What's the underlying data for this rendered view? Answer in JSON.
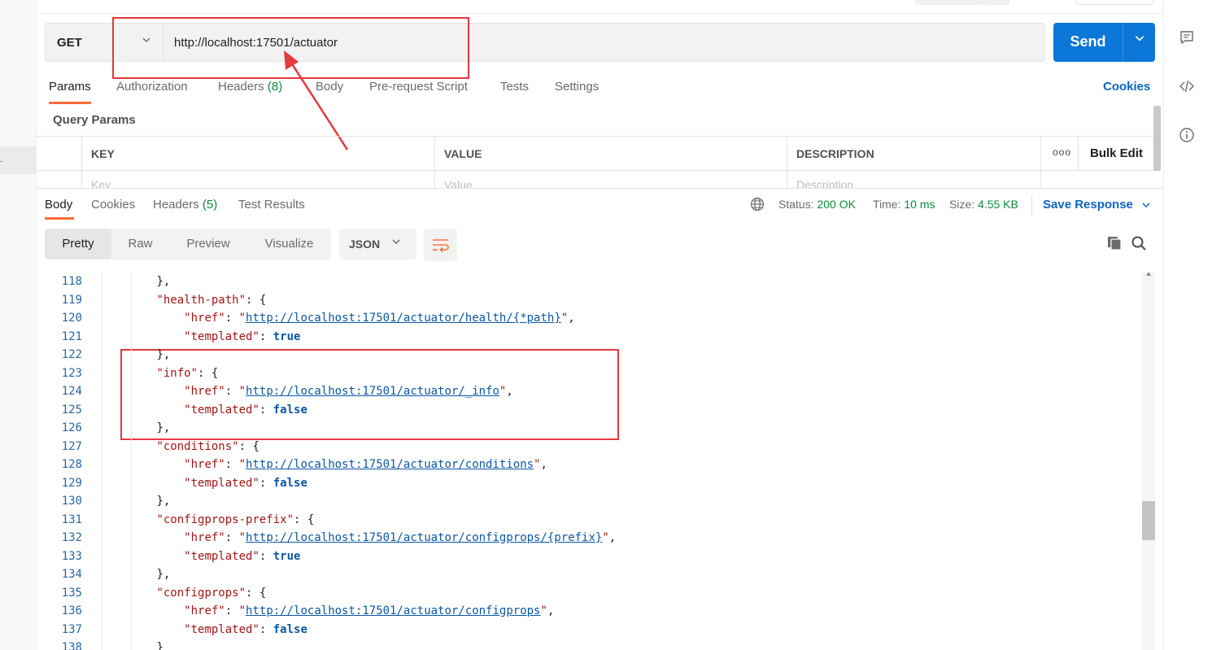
{
  "request": {
    "method": "GET",
    "url": "http://localhost:17501/actuator",
    "send_label": "Send"
  },
  "request_tabs": [
    {
      "label": "Params"
    },
    {
      "label": "Authorization"
    },
    {
      "label": "Headers",
      "count": "(8)"
    },
    {
      "label": "Body"
    },
    {
      "label": "Pre-request Script"
    },
    {
      "label": "Tests"
    },
    {
      "label": "Settings"
    }
  ],
  "cookies_label": "Cookies",
  "query_params": {
    "title": "Query Params",
    "headers": [
      "KEY",
      "VALUE",
      "DESCRIPTION"
    ],
    "placeholders": [
      "Key",
      "Value",
      "Description"
    ],
    "more_label": "ooo",
    "bulk_edit_label": "Bulk Edit"
  },
  "response_tabs": [
    {
      "label": "Body"
    },
    {
      "label": "Cookies"
    },
    {
      "label": "Headers",
      "count": "(5)"
    },
    {
      "label": "Test Results"
    }
  ],
  "status": {
    "status_label": "Status:",
    "status_value": "200 OK",
    "time_label": "Time:",
    "time_value": "10 ms",
    "size_label": "Size:",
    "size_value": "4.55 KB"
  },
  "save_response_label": "Save Response",
  "format_tabs": [
    "Pretty",
    "Raw",
    "Preview",
    "Visualize"
  ],
  "format_select": "JSON",
  "colors": {
    "accent": "#ff6c37",
    "send_blue": "#0b77d8",
    "link_blue": "#0b66c3",
    "success_green": "#0d8a3c",
    "annotation_red": "#e6383d"
  },
  "code_lines": [
    {
      "n": "118",
      "t": "        },"
    },
    {
      "n": "119",
      "t": "        \"health-path\": {"
    },
    {
      "n": "120",
      "t": "            \"href\": \"http://localhost:17501/actuator/health/{*path}\","
    },
    {
      "n": "121",
      "t": "            \"templated\": true"
    },
    {
      "n": "122",
      "t": "        },"
    },
    {
      "n": "123",
      "t": "        \"info\": {"
    },
    {
      "n": "124",
      "t": "            \"href\": \"http://localhost:17501/actuator/_info\","
    },
    {
      "n": "125",
      "t": "            \"templated\": false"
    },
    {
      "n": "126",
      "t": "        },"
    },
    {
      "n": "127",
      "t": "        \"conditions\": {"
    },
    {
      "n": "128",
      "t": "            \"href\": \"http://localhost:17501/actuator/conditions\","
    },
    {
      "n": "129",
      "t": "            \"templated\": false"
    },
    {
      "n": "130",
      "t": "        },"
    },
    {
      "n": "131",
      "t": "        \"configprops-prefix\": {"
    },
    {
      "n": "132",
      "t": "            \"href\": \"http://localhost:17501/actuator/configprops/{prefix}\","
    },
    {
      "n": "133",
      "t": "            \"templated\": true"
    },
    {
      "n": "134",
      "t": "        },"
    },
    {
      "n": "135",
      "t": "        \"configprops\": {"
    },
    {
      "n": "136",
      "t": "            \"href\": \"http://localhost:17501/actuator/configprops\","
    },
    {
      "n": "137",
      "t": "            \"templated\": false"
    },
    {
      "n": "138",
      "t": "        }"
    }
  ]
}
